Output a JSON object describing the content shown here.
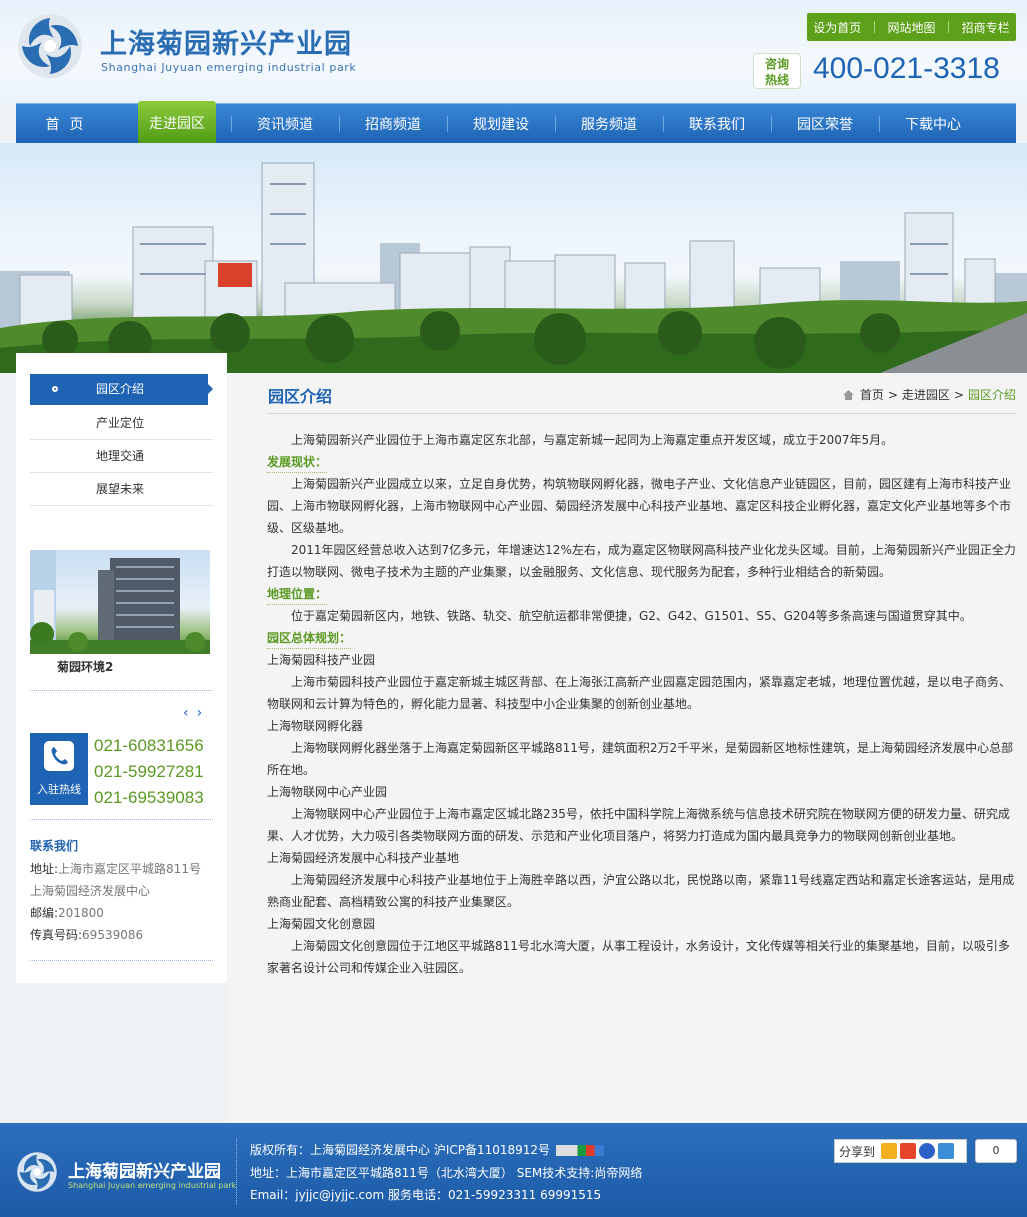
{
  "header": {
    "logo_cn": "上海菊园新兴产业园",
    "logo_en": "Shanghai Juyuan emerging industrial park",
    "top_links": [
      "设为首页",
      "网站地图",
      "招商专栏"
    ],
    "hotline_badge_line1": "咨询",
    "hotline_badge_line2": "热线",
    "hotline_number": "400-021-3318"
  },
  "nav": {
    "items": [
      "首页",
      "走进园区",
      "资讯频道",
      "招商频道",
      "规划建设",
      "服务频道",
      "联系我们",
      "园区荣誉",
      "下载中心"
    ],
    "active_index": 1
  },
  "sidebar": {
    "menu": [
      "园区介绍",
      "产业定位",
      "地理交通",
      "展望未来"
    ],
    "photo_caption": "菊园环境2",
    "pager_prev": "‹",
    "pager_next": "›",
    "hotline_label": "入驻热线",
    "phones": [
      "021-60831656",
      "021-59927281",
      "021-69539083"
    ],
    "contact_title": "联系我们",
    "address_label": "地址:",
    "address_value": "上海市嘉定区平城路811号",
    "address_line2": "上海菊园经济发展中心",
    "zip_label": "邮编:",
    "zip_value": "201800",
    "fax_label": "传真号码:",
    "fax_value": "69539086"
  },
  "content": {
    "title": "园区介绍",
    "breadcrumb": [
      "首页",
      "走进园区",
      "园区介绍"
    ],
    "breadcrumb_sep": ">",
    "p_intro": "上海菊园新兴产业园位于上海市嘉定区东北部，与嘉定新城一起同为上海嘉定重点开发区域，成立于2007年5月。",
    "sec_status": "发展现状：",
    "p_status1": "上海菊园新兴产业园成立以来，立足自身优势，构筑物联网孵化器，微电子产业、文化信息产业链园区，目前，园区建有上海市科技产业园、上海市物联网孵化器，上海市物联网中心产业园、菊园经济发展中心科技产业基地、嘉定区科技企业孵化器，嘉定文化产业基地等多个市级、区级基地。",
    "p_status2": "2011年园区经营总收入达到7亿多元，年增速达12%左右，成为嘉定区物联网高科技产业化龙头区域。目前，上海菊园新兴产业园正全力打造以物联网、微电子技术为主题的产业集聚，以金融服务、文化信息、现代服务为配套，多种行业相结合的新菊园。",
    "sec_location": "地理位置：",
    "p_location": "位于嘉定菊园新区内，地铁、铁路、轨交、航空航运都非常便捷，G2、G42、G1501、S5、G204等多条高速与国道贯穿其中。",
    "sec_plan": "园区总体规划：",
    "h1": "上海菊园科技产业园",
    "p1": "上海市菊园科技产业园位于嘉定新城主城区背部、在上海张江高新产业园嘉定园范围内，紧靠嘉定老城，地理位置优越，是以电子商务、物联网和云计算为特色的，孵化能力显著、科技型中小企业集聚的创新创业基地。",
    "h2": "上海物联网孵化器",
    "p2": "上海物联网孵化器坐落于上海嘉定菊园新区平城路811号，建筑面积2万2千平米，是菊园新区地标性建筑，是上海菊园经济发展中心总部所在地。",
    "h3": "上海物联网中心产业园",
    "p3": "上海物联网中心产业园位于上海市嘉定区城北路235号，依托中国科学院上海微系统与信息技术研究院在物联网方便的研发力量、研究成果、人才优势，大力吸引各类物联网方面的研发、示范和产业化项目落户，将努力打造成为国内最具竞争力的物联网创新创业基地。",
    "h4": "上海菊园经济发展中心科技产业基地",
    "p4": "上海菊园经济发展中心科技产业基地位于上海胜辛路以西，沪宜公路以北，民悦路以南，紧靠11号线嘉定西站和嘉定长途客运站，是用成熟商业配套、高档精致公寓的科技产业集聚区。",
    "h5": "上海菊园文化创意园",
    "p5": "上海菊园文化创意园位于江地区平城路811号北水湾大厦，从事工程设计，水务设计，文化传媒等相关行业的集聚基地，目前，以吸引多家著名设计公司和传媒企业入驻园区。"
  },
  "footer": {
    "logo_cn": "上海菊园新兴产业园",
    "logo_en": "Shanghai Juyuan emerging industrial park",
    "line1": "版权所有：上海菊园经济发展中心  沪ICP备11018912号",
    "line2": "地址：上海市嘉定区平城路811号（北水湾大厦）  SEM技术支持:尚帝网络",
    "line3": "Email：jyjjc@jyjjc.com 服务电话：021-59923311 69991515",
    "share_label": "分享到",
    "share_count": "0"
  },
  "colors": {
    "brand_blue": "#1f63b4",
    "accent_green": "#5a9a22"
  }
}
